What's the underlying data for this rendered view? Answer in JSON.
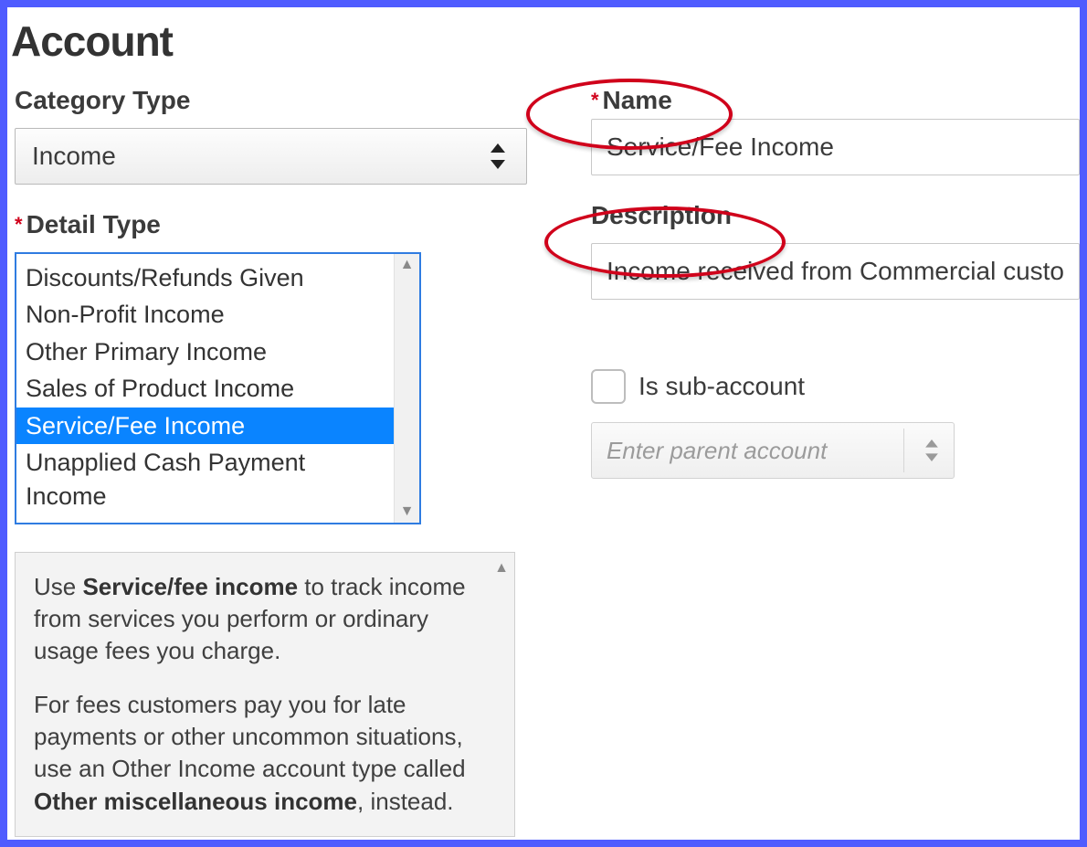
{
  "title": "Account",
  "left": {
    "category_label": "Category Type",
    "category_value": "Income",
    "detail_label": "Detail Type",
    "detail_options": [
      "Discounts/Refunds Given",
      "Non-Profit Income",
      "Other Primary Income",
      "Sales of Product Income",
      "Service/Fee Income",
      "Unapplied Cash Payment Income"
    ],
    "detail_selected_index": 4,
    "help": {
      "p1_pre": "Use ",
      "p1_bold": "Service/fee income",
      "p1_post": " to track income from services you perform or ordinary usage fees you charge.",
      "p2_pre": "For fees customers pay you for late payments or other uncommon situations, use an Other Income account type called ",
      "p2_bold": "Other miscellaneous income",
      "p2_post": ", instead."
    }
  },
  "right": {
    "name_label": "Name",
    "name_value": "Service/Fee Income",
    "desc_label": "Description",
    "desc_value": "Income received from Commercial custo",
    "sub_label": "Is sub-account",
    "parent_placeholder": "Enter parent account"
  }
}
